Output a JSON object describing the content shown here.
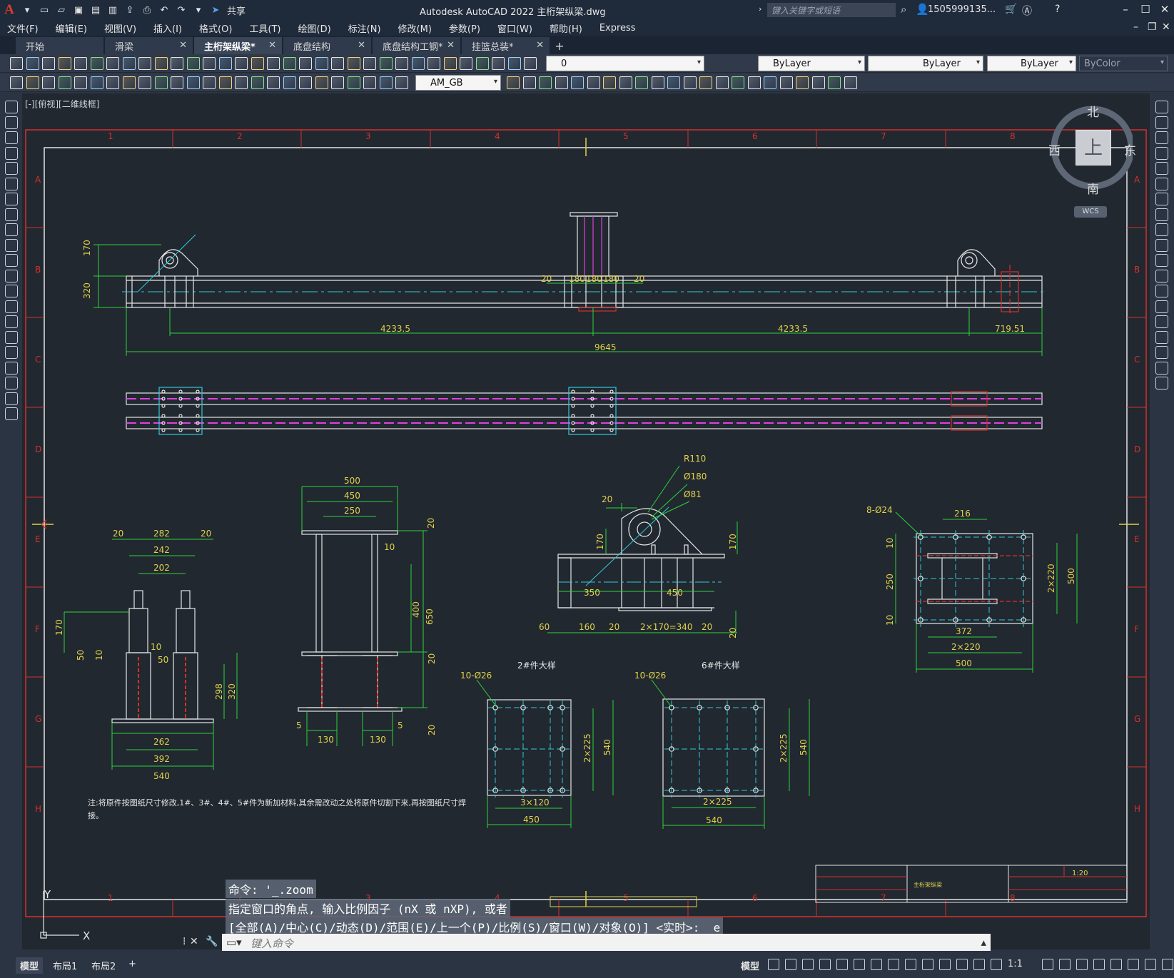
{
  "app": {
    "logo": "A",
    "window_title": "Autodesk AutoCAD 2022    主桁架纵梁.dwg",
    "share_label": "共享",
    "search_placeholder": "键入关键字或短语",
    "user_name": "1505999135...",
    "accent_color": "#e03a2f"
  },
  "menu": [
    "文件(F)",
    "编辑(E)",
    "视图(V)",
    "插入(I)",
    "格式(O)",
    "工具(T)",
    "绘图(D)",
    "标注(N)",
    "修改(M)",
    "参数(P)",
    "窗口(W)",
    "帮助(H)",
    "Express"
  ],
  "tabs": [
    {
      "label": "开始",
      "active": false
    },
    {
      "label": "滑梁",
      "active": false
    },
    {
      "label": "主桁架纵梁*",
      "active": true
    },
    {
      "label": "底盘结构",
      "active": false
    },
    {
      "label": "底盘结构工钢*",
      "active": false
    },
    {
      "label": "挂篮总装*",
      "active": false
    }
  ],
  "props": {
    "layer": "0",
    "color": "ByLayer",
    "linetype": "ByLayer",
    "lineweight": "ByLayer",
    "plotstyle": "ByColor",
    "dimstyle": "AM_GB"
  },
  "view_label": "[-][俯视][二维线框]",
  "viewcube": {
    "north": "北",
    "south": "南",
    "east": "东",
    "west": "西",
    "face": "上",
    "wcs": "WCS"
  },
  "frame": {
    "columns": [
      "1",
      "2",
      "3",
      "4",
      "5",
      "6",
      "7",
      "8"
    ],
    "rows": [
      "A",
      "B",
      "C",
      "D",
      "E",
      "F",
      "G",
      "H"
    ]
  },
  "dims": {
    "elevation": {
      "d170": "170",
      "d320": "320",
      "d20a": "20",
      "d180a": "180",
      "d180b": "180",
      "d180c": "180",
      "d20b": "20",
      "d4233a": "4233.5",
      "d4233b": "4233.5",
      "d719": "719.51",
      "d9645": "9645"
    },
    "section1": {
      "d20a": "20",
      "d282": "282",
      "d20b": "20",
      "d242": "242",
      "d202": "202",
      "d170": "170",
      "d50": "50",
      "d10": "10",
      "d10b": "10",
      "d50b": "50",
      "d298": "298",
      "d320": "320",
      "d262": "262",
      "d392": "392",
      "d540": "540"
    },
    "section2": {
      "d500": "500",
      "d450": "450",
      "d250": "250",
      "d20a": "20",
      "d10": "10",
      "d650": "650",
      "d400": "400",
      "d20b": "20",
      "d20c": "20",
      "d5a": "5",
      "d5b": "5",
      "d130a": "130",
      "d130b": "130"
    },
    "detail": {
      "r110": "R110",
      "phi180": "Ø180",
      "phi81": "Ø81",
      "d20": "20",
      "d170a": "170",
      "d170b": "170",
      "d350": "350",
      "d450": "450",
      "d60": "60",
      "d160": "160",
      "d20b": "20",
      "d2x170": "2×170=340",
      "d20c": "20",
      "d20d": "20"
    },
    "plate1": {
      "holes": "8-Ø24",
      "d216": "216",
      "d10a": "10",
      "d250": "250",
      "d10b": "10",
      "d2x220": "2×220",
      "d500": "500",
      "d372": "372",
      "d2x220b": "2×220",
      "d500b": "500"
    },
    "plate2": {
      "title": "2#件大样",
      "holes": "10-Ø26",
      "d2x225": "2×225",
      "d540": "540",
      "d3x120": "3×120",
      "d450": "450"
    },
    "plate3": {
      "title": "6#件大样",
      "holes": "10-Ø26",
      "d2x225": "2×225",
      "d540": "540",
      "d2x225b": "2×225",
      "d540b": "540"
    }
  },
  "note": {
    "line1": "注:将原件按图纸尺寸修改,1#、3#、4#、5#件为新加材料,其余需改动之处将原件切割下来,再按图纸尺寸焊",
    "line2": "接。"
  },
  "titleblock": {
    "name": "主桁架纵梁",
    "scale": "1:20"
  },
  "ucs": {
    "y": "Y",
    "x": "X"
  },
  "command": {
    "history": [
      "命令: '_.zoom",
      "指定窗口的角点, 输入比例因子 (nX 或 nXP), 或者",
      "[全部(A)/中心(C)/动态(D)/范围(E)/上一个(P)/比例(S)/窗口(W)/对象(O)] <实时>: _e"
    ],
    "input_placeholder": "键入命令"
  },
  "layouts": [
    {
      "label": "模型",
      "active": true
    },
    {
      "label": "布局1",
      "active": false
    },
    {
      "label": "布局2",
      "active": false
    }
  ],
  "status": {
    "model": "模型",
    "scale": "1:1"
  }
}
